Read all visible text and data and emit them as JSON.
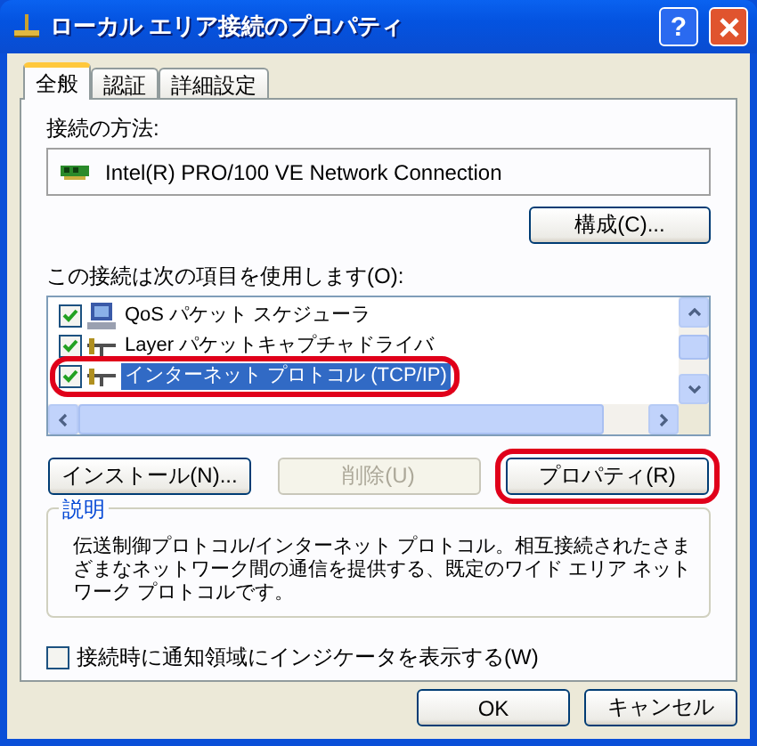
{
  "window": {
    "title": "ローカル エリア接続のプロパティ",
    "help_label": "?"
  },
  "tabs": [
    {
      "label": "全般",
      "selected": true
    },
    {
      "label": "認証",
      "selected": false
    },
    {
      "label": "詳細設定",
      "selected": false
    }
  ],
  "connect_using": {
    "label": "接続の方法:",
    "adapter": "Intel(R) PRO/100 VE Network Connection",
    "configure_button": "構成(C)..."
  },
  "components": {
    "label": "この接続は次の項目を使用します(O):",
    "items": [
      {
        "label": "QoS パケット スケジューラ",
        "kind": "service",
        "checked": true,
        "selected": false,
        "highlighted": false
      },
      {
        "label": "Layer パケットキャプチャドライバ",
        "kind": "protocol",
        "checked": true,
        "selected": false,
        "highlighted": false
      },
      {
        "label": "インターネット プロトコル (TCP/IP)",
        "kind": "protocol",
        "checked": true,
        "selected": true,
        "highlighted": true
      }
    ]
  },
  "item_buttons": [
    {
      "label": "インストール(N)...",
      "disabled": false,
      "highlighted": false
    },
    {
      "label": "削除(U)",
      "disabled": true,
      "highlighted": false
    },
    {
      "label": "プロパティ(R)",
      "disabled": false,
      "highlighted": true
    }
  ],
  "description": {
    "title": "説明",
    "text": "伝送制御プロトコル/インターネット プロトコル。相互接続されたさまざまなネットワーク間の通信を提供する、既定のワイド エリア ネットワーク プロトコルです。"
  },
  "indicator_checkbox": {
    "label": "接続時に通知領域にインジケータを表示する(W)",
    "checked": false
  },
  "dialog_buttons": [
    {
      "label": "OK"
    },
    {
      "label": "キャンセル"
    }
  ]
}
